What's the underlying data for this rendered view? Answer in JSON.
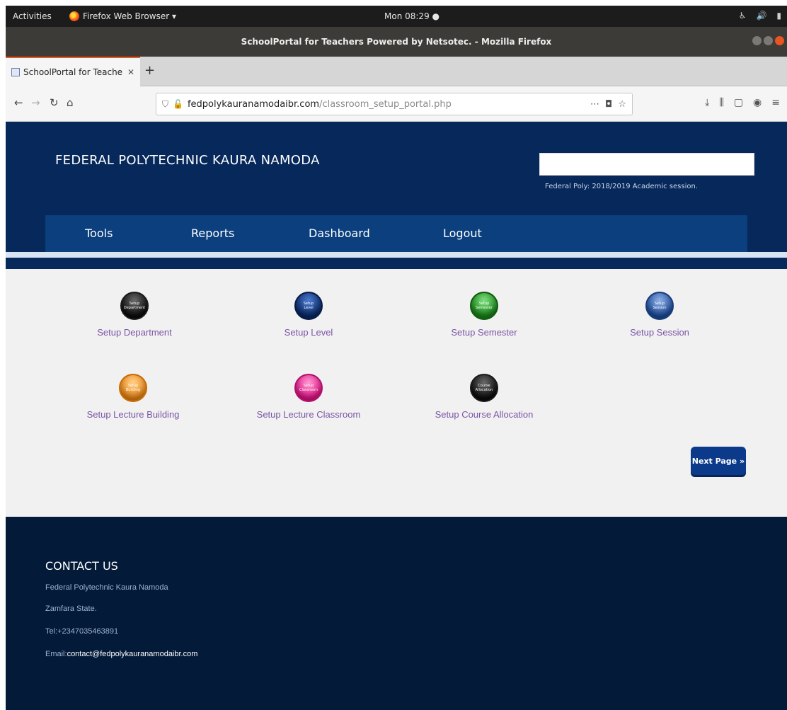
{
  "os_bar": {
    "activities": "Activities",
    "app_name": "Firefox Web Browser ▾",
    "clock": "Mon 08:29 ●"
  },
  "browser": {
    "window_title": "SchoolPortal for Teachers Powered by Netsotec. - Mozilla Firefox",
    "tab_label": "SchoolPortal for Teache",
    "url_domain": "fedpolykauranamodaibr.com",
    "url_path": "/classroom_setup_portal.php"
  },
  "header": {
    "school_name": "FEDERAL POLYTECHNIC KAURA NAMODA",
    "session_text": "Federal Poly: 2018/2019 Academic session.",
    "search_value": ""
  },
  "menu": {
    "tools": "Tools",
    "reports": "Reports",
    "dashboard": "Dashboard",
    "logout": "Logout"
  },
  "tiles": [
    {
      "label": "Setup Department",
      "orb_top": "Setup",
      "orb_bottom": "Department"
    },
    {
      "label": "Setup Level",
      "orb_top": "Setup",
      "orb_bottom": "Level"
    },
    {
      "label": "Setup Semester",
      "orb_top": "Setup",
      "orb_bottom": "Semester"
    },
    {
      "label": "Setup Session",
      "orb_top": "Setup",
      "orb_bottom": "Session"
    },
    {
      "label": "Setup Lecture Building",
      "orb_top": "Setup",
      "orb_bottom": "Building"
    },
    {
      "label": "Setup Lecture Classroom",
      "orb_top": "Setup",
      "orb_bottom": "Classroom"
    },
    {
      "label": "Setup Course Allocation",
      "orb_top": "Course",
      "orb_bottom": "Allocation"
    }
  ],
  "next_button": {
    "label": "Next Page",
    "arrow": "»"
  },
  "footer": {
    "title": "CONTACT US",
    "line1": "Federal Polytechnic Kaura Namoda",
    "line2": "Zamfara State.",
    "phone": "Tel:+2347035463891",
    "email_label": "Email:",
    "email_value": "contact@fedpolykauranamodaibr.com"
  },
  "colors": {
    "header_bg": "#06285a",
    "menu_bg": "#0b3f7e",
    "footer_bg": "#031a38",
    "link_purple": "#7b55a6",
    "button_blue": "#0b3a8a"
  }
}
